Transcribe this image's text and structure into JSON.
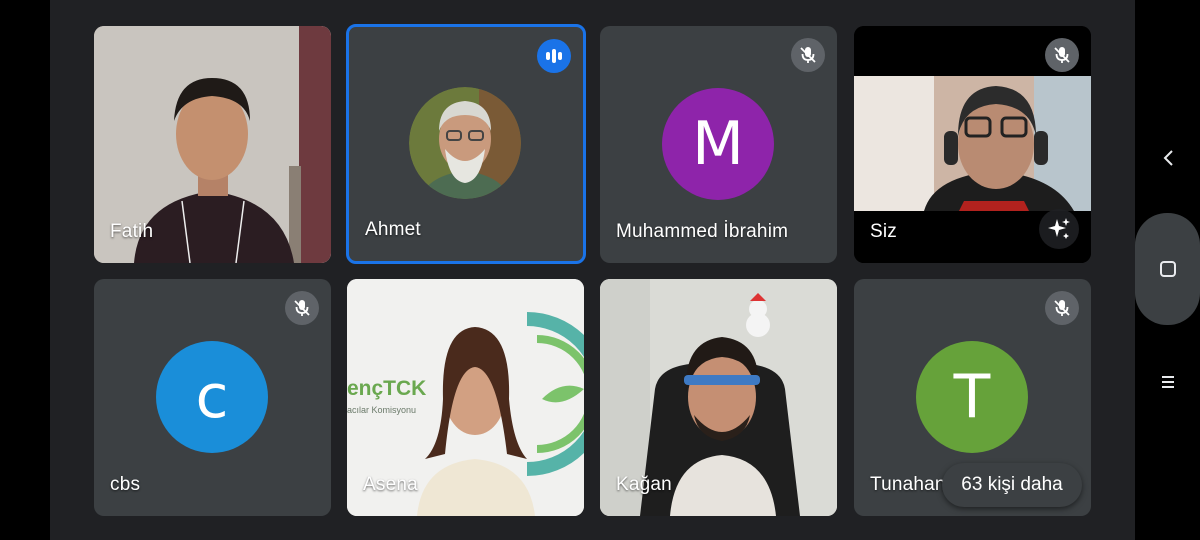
{
  "participants": [
    {
      "name": "Fatih",
      "kind": "video"
    },
    {
      "name": "Ahmet",
      "kind": "photo-avatar",
      "status": "speaking"
    },
    {
      "name": "Muhammed İbrahim",
      "kind": "letter-avatar",
      "initial": "M",
      "color": "#8e24aa",
      "status": "muted"
    },
    {
      "name": "Siz",
      "kind": "video",
      "status": "muted",
      "is_self": true
    },
    {
      "name": "cbs",
      "kind": "letter-avatar",
      "initial": "c",
      "color": "#1a8ed9",
      "status": "muted"
    },
    {
      "name": "Asena",
      "kind": "video"
    },
    {
      "name": "Kağan",
      "kind": "video"
    },
    {
      "name": "Tunahan",
      "kind": "letter-avatar",
      "initial": "T",
      "color": "#66a23a",
      "status": "muted"
    }
  ],
  "asena_background_text": {
    "brand": "ençTCK",
    "subtitle": "acılar Komisyonu"
  },
  "more_people_label": "63 kişi daha",
  "icons": {
    "muted": "mic-off-icon",
    "speaking": "audio-bars-icon",
    "effects": "sparkle-icon",
    "nav_back": "chevron-left-icon",
    "nav_home": "square-icon",
    "nav_recents": "three-lines-icon"
  },
  "colors": {
    "stage": "#202124",
    "tile": "#3c4043",
    "speaking_border": "#1a73e8",
    "badge": "#5f6368"
  }
}
